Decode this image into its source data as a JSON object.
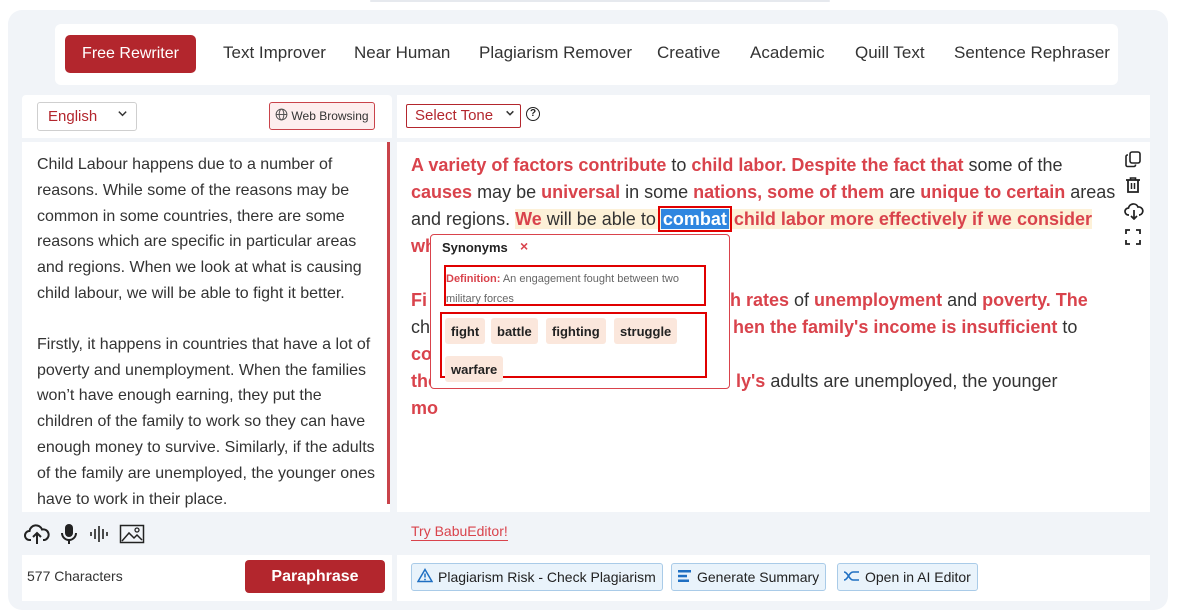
{
  "modes": [
    "Free Rewriter",
    "Text Improver",
    "Near Human",
    "Plagiarism Remover",
    "Creative",
    "Academic",
    "Quill Text",
    "Sentence Rephraser"
  ],
  "language": {
    "selected": "English"
  },
  "web_browsing_label": "Web Browsing",
  "input": {
    "paragraphs": [
      "Child Labour happens due to a number of reasons. While some of the reasons may be common in some countries, there are some reasons which are specific in particular areas and regions. When we look at what is causing child labour, we will be able to fight it better.",
      "Firstly, it happens in countries that have a lot of poverty and unemployment. When the families won’t have enough earning, they put the children of the family to work so they can have enough money to survive. Similarly, if the adults of the family are unemployed, the younger ones have to work in their place."
    ]
  },
  "char_count": "577 Characters",
  "paraphrase_label": "Paraphrase",
  "tone": {
    "selected": "Select Tone"
  },
  "help_label": "?",
  "output": {
    "p1": {
      "s1": "A variety of factors contribute",
      "s2": " to ",
      "s3": "child labor. Despite the fact that",
      "s4": " some of the ",
      "s5": "causes",
      "s6": " may be ",
      "s7": "universal",
      "s8": " in some ",
      "s9": "nations, some of them",
      "s10": " are ",
      "s11": "unique to certain",
      "s12": " areas and regions. ",
      "s13": "We",
      "s14": " will be able to ",
      "s15": "combat",
      "s16": " child labor more effectively if we consider",
      "s17": " wh"
    },
    "p2": {
      "a1": "Fi",
      "a2": "gh rates",
      "a3": " of ",
      "a4": "unemployment",
      "a5": " and ",
      "a6": "poverty. The",
      "b1": "ch",
      "b2": "hen the family's income is insufficient",
      "b3": " to ",
      "b4": "cover",
      "c1": "the",
      "c2": "ly's",
      "c3": " adults are unemployed, the younger",
      "d1": "mo"
    }
  },
  "synonyms_popup": {
    "title": "Synonyms",
    "close": "×",
    "definition_label": "Definition:",
    "definition": "An engagement fought between two military forces",
    "words": [
      "fight",
      "battle",
      "fighting",
      "struggle",
      "warfare"
    ]
  },
  "try_link": "Try BabuEditor!",
  "footer_buttons": [
    "Plagiarism Risk - Check Plagiarism",
    "Generate Summary",
    "Open in AI Editor"
  ],
  "colors": {
    "brand": "#b3262d",
    "accent_text": "#d9434c",
    "selection": "#2f86e0",
    "panel_bg": "#f1f4f8"
  }
}
